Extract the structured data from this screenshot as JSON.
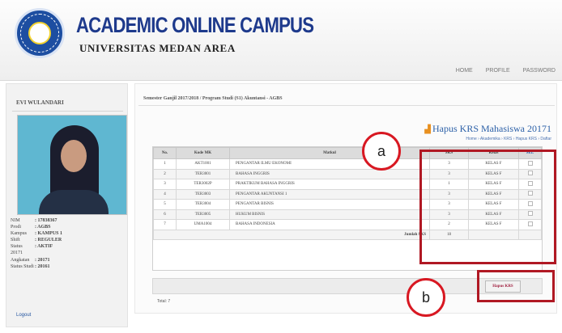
{
  "header": {
    "title": "ACADEMIC ONLINE CAMPUS",
    "subtitle": "UNIVERSITAS MEDAN AREA",
    "nav": [
      "HOME",
      "PROFILE",
      "PASSWORD"
    ]
  },
  "sidebar": {
    "user_name": "EVI WULANDARI",
    "info": [
      {
        "key": "NIM",
        "value": ": 17838367"
      },
      {
        "key": "Prodi",
        "value": ": AGBS"
      },
      {
        "key": "Kampus",
        "value": ": KAMPUS 1"
      },
      {
        "key": "Shift",
        "value": ": REGULER"
      },
      {
        "key": "Status",
        "value": ": AKTIF"
      },
      {
        "key": "20171",
        "value": ""
      },
      {
        "key": "Angkatan",
        "value": ": 20171"
      },
      {
        "key": "Status Studi",
        "value": ": 20161"
      }
    ],
    "logout": "Logout"
  },
  "content": {
    "heading": "Semester Ganjil 2017/2018 / Program Studi (S1) Akuntansi - AGBS",
    "page_title": "Hapus KRS Mahasiswa 20171",
    "breadcrumb": "Home › Akademika › KRS › Hapus KRS › Daftar",
    "table": {
      "headers": [
        "No.",
        "Kode MK",
        "Matkul",
        "SKS",
        "Kelas",
        "SEL"
      ],
      "rows": [
        {
          "no": "1",
          "kode": "AKT1001",
          "matkul": "PENGANTAR ILMU EKONOMI",
          "sks": "3",
          "kelas": "KELAS F"
        },
        {
          "no": "2",
          "kode": "TER3001",
          "matkul": "BAHASA INGGRIS",
          "sks": "3",
          "kelas": "KELAS F"
        },
        {
          "no": "3",
          "kode": "TER3002P",
          "matkul": "PRAKTIKUM BAHASA INGGRIS",
          "sks": "1",
          "kelas": "KELAS F"
        },
        {
          "no": "4",
          "kode": "TER3003",
          "matkul": "PENGANTAR AKUNTANSI 1",
          "sks": "3",
          "kelas": "KELAS F"
        },
        {
          "no": "5",
          "kode": "TER3004",
          "matkul": "PENGANTAR BISNIS",
          "sks": "3",
          "kelas": "KELAS F"
        },
        {
          "no": "6",
          "kode": "TER3005",
          "matkul": "HUKUM BISNIS",
          "sks": "3",
          "kelas": "KELAS F"
        },
        {
          "no": "7",
          "kode": "UMA1004",
          "matkul": "BAHASA INDONESIA",
          "sks": "2",
          "kelas": "KELAS F"
        }
      ],
      "total_label": "Jumlah SKS"
    },
    "submit_label": "Hapus KRS",
    "footer": "Total: 7"
  },
  "annotations": {
    "a": "a",
    "b": "b",
    "highlight_color": "#b01823",
    "callout_color": "#d81822"
  }
}
